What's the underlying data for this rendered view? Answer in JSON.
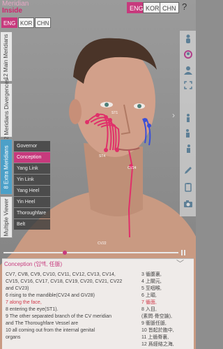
{
  "app": {
    "logo_line1": "Meridian",
    "logo_line2": "Inside"
  },
  "top_languages": [
    "ENG",
    "KOR",
    "CHN"
  ],
  "top_language_selected": "ENG",
  "help_label": "?",
  "second_languages": [
    "ENG",
    "KOR",
    "CHN"
  ],
  "second_language_selected": "ENG",
  "left_tabs": [
    {
      "label": "12 Main Meridians",
      "active": false
    },
    {
      "label": "12 Meridians Divergences",
      "active": false
    },
    {
      "label": "8 Extra Meridians",
      "active": true
    },
    {
      "label": "Multiple Viewer",
      "active": false
    }
  ],
  "meridians": [
    {
      "label": "Governor",
      "selected": false
    },
    {
      "label": "Conception",
      "selected": true
    },
    {
      "label": "Yang Link",
      "selected": false
    },
    {
      "label": "Yin Link",
      "selected": false
    },
    {
      "label": "Yang Heel",
      "selected": false
    },
    {
      "label": "Yin Heel",
      "selected": false
    },
    {
      "label": "Thoroughfare",
      "selected": false
    },
    {
      "label": "Belt",
      "selected": false
    }
  ],
  "figure_labels": {
    "st4": "ST4",
    "cv24": "CV24",
    "cv22": "CV22",
    "st1": "ST1"
  },
  "right_tools": [
    {
      "icon": "person-body-icon"
    },
    {
      "icon": "person-head-icon"
    },
    {
      "icon": "shoulder-view-icon"
    },
    {
      "icon": "expand-view-icon"
    },
    {
      "icon": "front-figure-icon"
    },
    {
      "icon": "side-figure-icon"
    },
    {
      "icon": "back-figure-icon"
    },
    {
      "icon": "pencil-icon"
    },
    {
      "icon": "clipboard-icon"
    },
    {
      "icon": "camera-icon"
    }
  ],
  "panel": {
    "title": "Conception (임맥, 任脈)",
    "english_lines": [
      "CV7, CVB, CV9, CV10, CV11, CV12, CV13, CV14,",
      "CV15, CV16, CV17, CV18, CV19, CV20, CV21, CV22",
      "and CV23)",
      "6 rising to the mandible(CV24 and GV28)",
      "7 along the face,",
      "8 entering the eye(ST1).",
      "9 The other separated branch of the CV meridian",
      "and The Thoroughfare Vessel are",
      "10 all coming out from the internal genital",
      "organs"
    ],
    "chinese_lines": [
      "3 循腹裏,",
      "4 上關元,",
      "5 至咽喉,",
      "6 上頤,",
      "7 循面,",
      "8 入目,",
      "(素問·骨空論),",
      "9 衝脈任脈,",
      "10 皆起於胞中,",
      "11 上循脊裏,",
      "12 爲經絡之海,"
    ]
  },
  "colors": {
    "accent": "#c73a7d",
    "active_tab": "#4ca0c8"
  }
}
